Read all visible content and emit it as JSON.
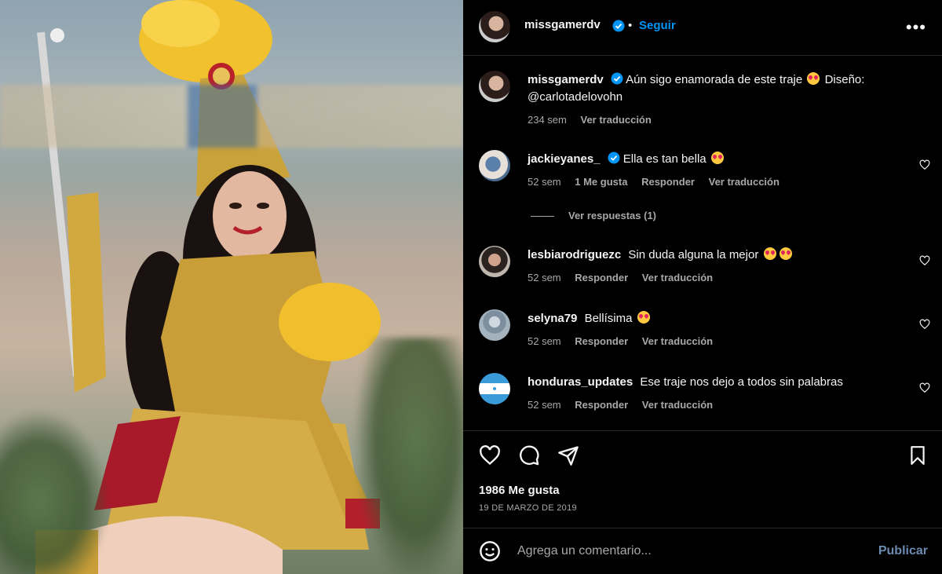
{
  "header": {
    "username": "missgamerdv",
    "separator": "•",
    "follow_label": "Seguir",
    "more_label": "•••"
  },
  "caption": {
    "username": "missgamerdv",
    "text": "Aún sigo enamorada de este traje",
    "text2": "Diseño: @carlotadelovohn",
    "time": "234 sem",
    "translate": "Ver traducción"
  },
  "comments": [
    {
      "username": "jackieyanes_",
      "text": "Ella es tan bella",
      "time": "52 sem",
      "likes": "1 Me gusta",
      "reply": "Responder",
      "translate": "Ver traducción",
      "view_replies": "Ver respuestas (1)"
    },
    {
      "username": "lesbiarodriguezc",
      "text": "Sin duda alguna la mejor",
      "time": "52 sem",
      "reply": "Responder",
      "translate": "Ver traducción"
    },
    {
      "username": "selyna79",
      "text": "Bellísima",
      "time": "52 sem",
      "reply": "Responder",
      "translate": "Ver traducción"
    },
    {
      "username": "honduras_updates",
      "text": "Ese traje nos dejo a todos sin palabras",
      "time": "52 sem",
      "reply": "Responder",
      "translate": "Ver traducción"
    }
  ],
  "post": {
    "likes": "1986 Me gusta",
    "date": "19 DE MARZO DE 2019"
  },
  "composer": {
    "placeholder": "Agrega un comentario...",
    "publish_label": "Publicar"
  },
  "colors": {
    "accent": "#0095f6",
    "muted": "#a8a8a8",
    "background": "#000000"
  }
}
